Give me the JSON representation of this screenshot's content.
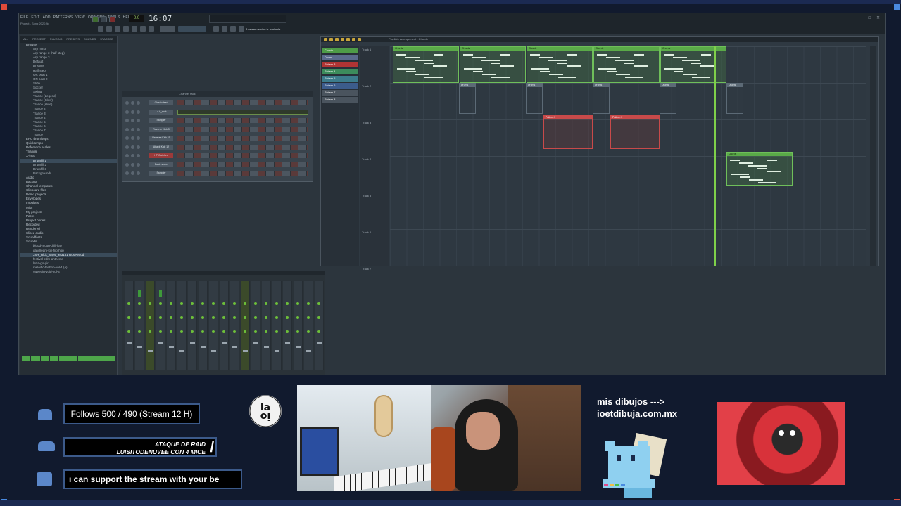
{
  "window": {
    "menu": [
      "FILE",
      "EDIT",
      "ADD",
      "PATTERNS",
      "VIEW",
      "OPTIONS",
      "TOOLS",
      "HELP"
    ],
    "hint": "Project - Song 2020.flp",
    "clock": "16:07",
    "clock_ms": "00",
    "tempo": "0.0",
    "hint2": "A newer version is available",
    "win_controls": "_ □ ✕"
  },
  "browser": {
    "tabs": [
      "ALL",
      "PROJECT",
      "PLUGINS",
      "PRESETS",
      "SOUNDS",
      "STARRED"
    ],
    "items": [
      {
        "label": "Browser",
        "type": "folder"
      },
      {
        "label": "Arp minor",
        "type": "item"
      },
      {
        "label": "Arp range 3 (half step)",
        "type": "item"
      },
      {
        "label": "Arp range 3",
        "type": "item"
      },
      {
        "label": "Default",
        "type": "item"
      },
      {
        "label": "Dreams",
        "type": "item"
      },
      {
        "label": "Half step",
        "type": "item"
      },
      {
        "label": "OR beat 1",
        "type": "item"
      },
      {
        "label": "OR beat 2",
        "type": "item"
      },
      {
        "label": "Slide",
        "type": "item"
      },
      {
        "label": "Soccer",
        "type": "item"
      },
      {
        "label": "Swing",
        "type": "item"
      },
      {
        "label": "Trance (Legend)",
        "type": "item"
      },
      {
        "label": "Trance (Slow)",
        "type": "item"
      },
      {
        "label": "Trance (slide)",
        "type": "item"
      },
      {
        "label": "Trance 2",
        "type": "item"
      },
      {
        "label": "Trance 3",
        "type": "item"
      },
      {
        "label": "Trance 4",
        "type": "item"
      },
      {
        "label": "Trance 5",
        "type": "item"
      },
      {
        "label": "Trance 6",
        "type": "item"
      },
      {
        "label": "Trance 7",
        "type": "item"
      },
      {
        "label": "Trance",
        "type": "item"
      },
      {
        "label": "EPC drumloops",
        "type": "folder"
      },
      {
        "label": "Quicktempo",
        "type": "folder"
      },
      {
        "label": "Reference scales",
        "type": "folder"
      },
      {
        "label": "Triangle",
        "type": "folder"
      },
      {
        "label": "X-ings",
        "type": "folder"
      },
      {
        "label": "Drumfill 1",
        "type": "sel"
      },
      {
        "label": "Drumfill 2",
        "type": "item"
      },
      {
        "label": "Drumfill 3",
        "type": "item"
      },
      {
        "label": "Backgrounds",
        "type": "item"
      },
      {
        "label": "Audio",
        "type": "folder"
      },
      {
        "label": "Backup",
        "type": "folder"
      },
      {
        "label": "Channel templates",
        "type": "folder"
      },
      {
        "label": "Clipboard files",
        "type": "folder"
      },
      {
        "label": "Demo projects",
        "type": "folder"
      },
      {
        "label": "Envelopes",
        "type": "folder"
      },
      {
        "label": "Impulses",
        "type": "folder"
      },
      {
        "label": "Misc",
        "type": "folder"
      },
      {
        "label": "My projects",
        "type": "folder"
      },
      {
        "label": "Packs",
        "type": "folder"
      },
      {
        "label": "Project bones",
        "type": "folder"
      },
      {
        "label": "Recorded",
        "type": "folder"
      },
      {
        "label": "Rendered",
        "type": "folder"
      },
      {
        "label": "Sliced audio",
        "type": "folder"
      },
      {
        "label": "Soundfonts",
        "type": "folder"
      },
      {
        "label": "Sounds",
        "type": "folder"
      },
      {
        "label": "blood-moon-drill-hay",
        "type": "item"
      },
      {
        "label": "daydream-lofi-hip-hop",
        "type": "item"
      },
      {
        "label": "JSR_Rick_Says_983161 Rosewood",
        "type": "sel"
      },
      {
        "label": "festival-edm-anthems",
        "type": "item"
      },
      {
        "label": "let-a-go-girl",
        "type": "item"
      },
      {
        "label": "melodic-techno-vol-1 (a)",
        "type": "item"
      },
      {
        "label": "sweet-in-void-vol-4",
        "type": "item"
      }
    ]
  },
  "channel_rack": {
    "title": "Channel rack",
    "channels": [
      {
        "name": "Classic lead",
        "color": "normal"
      },
      {
        "name": "Lo-fi_rock",
        "color": "normal"
      },
      {
        "name": "Sampler",
        "color": "normal"
      },
      {
        "name": "Reverse Kick 3",
        "color": "normal"
      },
      {
        "name": "Reverse Kick 11",
        "color": "normal"
      },
      {
        "name": "Attack Kick 12",
        "color": "normal"
      },
      {
        "name": "HP Clutched",
        "color": "red"
      },
      {
        "name": "Basic snare",
        "color": "normal"
      },
      {
        "name": "Sampler",
        "color": "normal"
      }
    ]
  },
  "playlist": {
    "title": "Playlist - Arrangement › Chords",
    "patterns": [
      {
        "label": "Chords",
        "color": "#4e9c48"
      },
      {
        "label": "Drums",
        "color": "#5a6a8c"
      },
      {
        "label": "Pattern 3",
        "color": "#b03434"
      },
      {
        "label": "Pattern 4",
        "color": "#3c8c5c"
      },
      {
        "label": "Pattern 5",
        "color": "#3c7c8c"
      },
      {
        "label": "Pattern 6",
        "color": "#3c5c8c"
      },
      {
        "label": "Pattern 7",
        "color": "#4a545e"
      },
      {
        "label": "Pattern 8",
        "color": "#4a545e"
      }
    ],
    "tracks": [
      "Track 1",
      "Track 2",
      "Track 3",
      "Track 4",
      "Track 5",
      "Track 6",
      "Track 7"
    ],
    "clip_labels": {
      "chords": "Chords",
      "drums": "Drums",
      "pattern3": "Pattern 3"
    }
  },
  "overlay": {
    "follows": "Follows 500 / 490 (Stream 12 H)",
    "raid_line1": "ATAQUE DE RAID",
    "raid_line2": "LUISITODENUVEE CON 4 MICE",
    "raid_slash": "/",
    "ticker": "ı can support the stream with your be",
    "logo": "la  oi",
    "promo_line1": "mis dibujos --->",
    "promo_line2": "ioetdibuja.com.mx"
  }
}
